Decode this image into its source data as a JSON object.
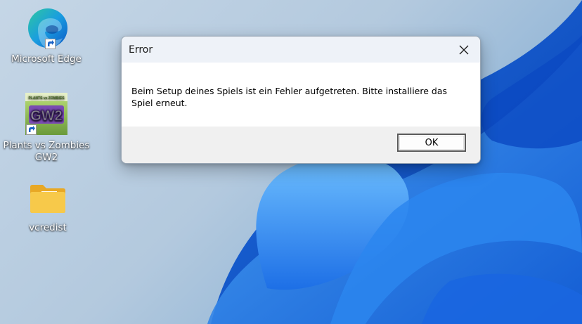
{
  "desktop": {
    "icons": [
      {
        "label": "Microsoft Edge",
        "icon": "edge-icon"
      },
      {
        "label": "Plants vs Zombies GW2",
        "icon": "pvz-gw2-icon",
        "art_text": "GW2"
      },
      {
        "label": "vcredist",
        "icon": "folder-icon"
      }
    ]
  },
  "dialog": {
    "title": "Error",
    "message": "Beim Setup deines Spiels ist ein Fehler aufgetreten. Bitte installiere das Spiel erneut.",
    "ok_label": "OK"
  }
}
